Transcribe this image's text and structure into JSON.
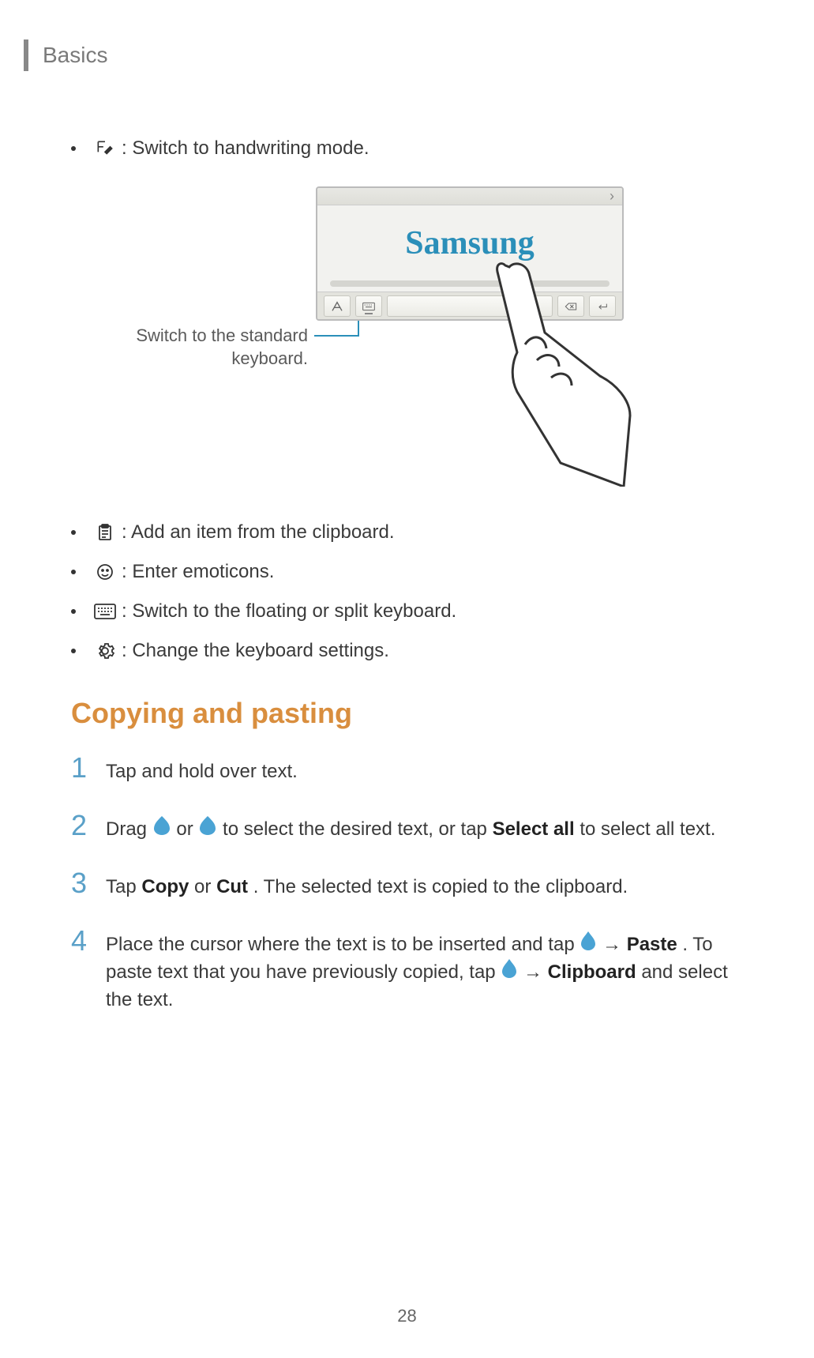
{
  "header": {
    "title": "Basics"
  },
  "bullets_top": [
    {
      "icon": "handwriting-icon",
      "text": " : Switch to handwriting mode."
    }
  ],
  "figure": {
    "callout": "Switch to the standard keyboard.",
    "handwriting_sample": "Samsung"
  },
  "bullets_bottom": [
    {
      "icon": "clipboard-icon",
      "text": " : Add an item from the clipboard."
    },
    {
      "icon": "emoticon-icon",
      "text": " : Enter emoticons."
    },
    {
      "icon": "keyboard-icon",
      "text": " : Switch to the floating or split keyboard."
    },
    {
      "icon": "settings-icon",
      "text": " : Change the keyboard settings."
    }
  ],
  "section": {
    "heading": "Copying and pasting"
  },
  "steps": [
    {
      "num": "1",
      "text_pre": "Tap and hold over text.",
      "text_mid": "",
      "bold1": "",
      "text_post": ""
    },
    {
      "num": "2",
      "text_pre": "Drag ",
      "icon1": "selection-handle-left",
      "text_mid1": " or ",
      "icon2": "selection-handle-right",
      "text_mid2": " to select the desired text, or tap ",
      "bold1": "Select all",
      "text_post": " to select all text."
    },
    {
      "num": "3",
      "text_pre": "Tap ",
      "bold1": "Copy",
      "text_mid1": " or ",
      "bold2": "Cut",
      "text_post": ". The selected text is copied to the clipboard."
    },
    {
      "num": "4",
      "text_pre": "Place the cursor where the text is to be inserted and tap ",
      "icon1": "cursor-handle",
      "arrow1": " → ",
      "bold1": "Paste",
      "text_mid1": ". To paste text that you have previously copied, tap ",
      "icon2": "cursor-handle",
      "arrow2": " → ",
      "bold2": "Clipboard",
      "text_post": " and select the text."
    }
  ],
  "page_number": "28"
}
